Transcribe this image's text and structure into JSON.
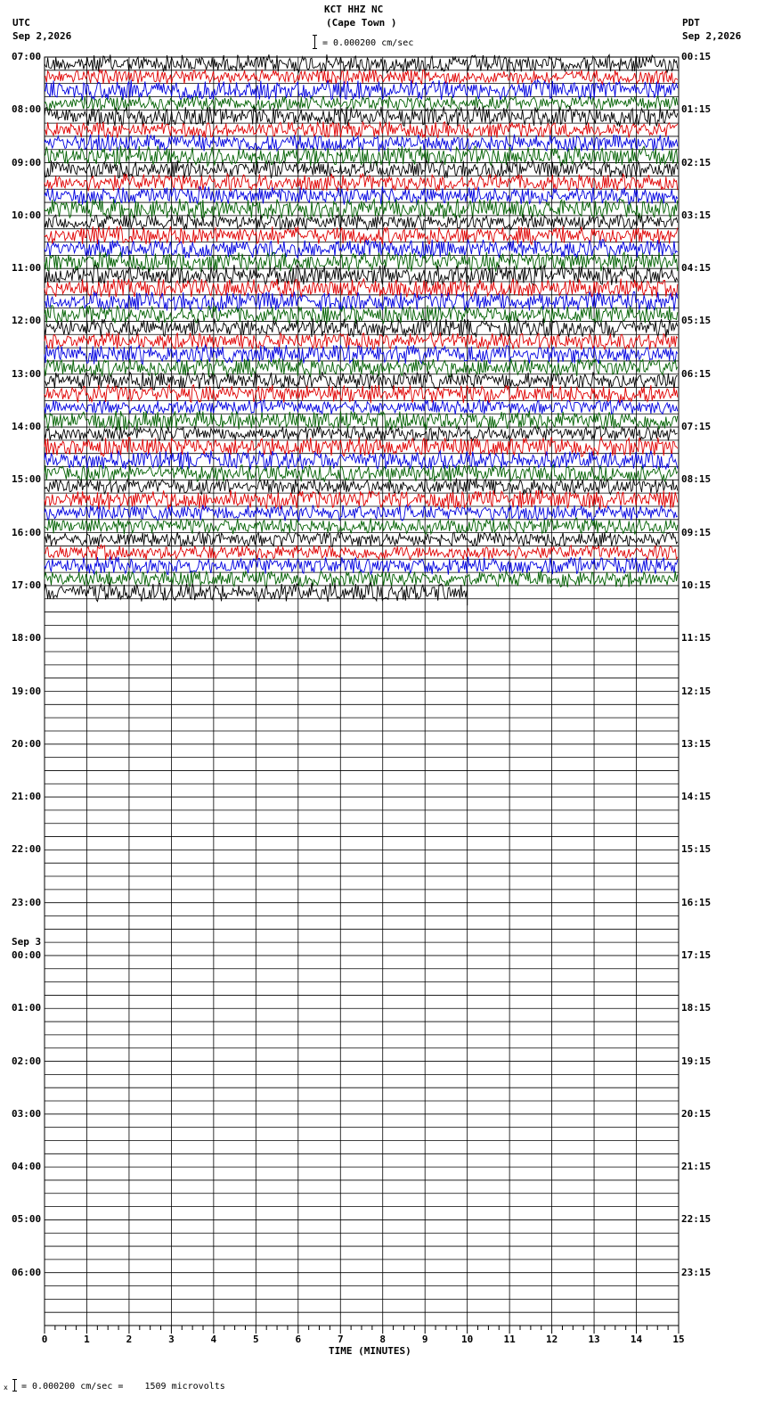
{
  "header": {
    "station": "KCT HHZ NC",
    "location": "(Cape Town )",
    "scale_text": "= 0.000200 cm/sec",
    "left_zone": "UTC",
    "left_date": "Sep 2,2026",
    "right_zone": "PDT",
    "right_date": "Sep 2,2026"
  },
  "footer": {
    "scale_note": "= 0.000200 cm/sec =    1509 microvolts"
  },
  "chart_data": {
    "type": "helicorder",
    "title": "KCT HHZ NC (Cape Town )",
    "xlabel": "TIME (MINUTES)",
    "x_ticks": [
      "0",
      "1",
      "2",
      "3",
      "4",
      "5",
      "6",
      "7",
      "8",
      "9",
      "10",
      "11",
      "12",
      "13",
      "14",
      "15"
    ],
    "xlim": [
      0,
      15
    ],
    "minutes_per_line": 15,
    "lines_total": 96,
    "lines_with_data": 41,
    "last_line_end_minute": 10,
    "trace_colors": [
      "#000000",
      "#e00000",
      "#0000e0",
      "#006000"
    ],
    "utc_labels": [
      "07:00",
      "08:00",
      "09:00",
      "10:00",
      "11:00",
      "12:00",
      "13:00",
      "14:00",
      "15:00",
      "16:00",
      "17:00",
      "18:00",
      "19:00",
      "20:00",
      "21:00",
      "22:00",
      "23:00",
      "00:00",
      "01:00",
      "02:00",
      "03:00",
      "04:00",
      "05:00",
      "06:00"
    ],
    "date_change_label": "Sep 3",
    "date_change_index": 17,
    "pdt_labels": [
      "00:15",
      "01:15",
      "02:15",
      "03:15",
      "04:15",
      "05:15",
      "06:15",
      "07:15",
      "08:15",
      "09:15",
      "10:15",
      "11:15",
      "12:15",
      "13:15",
      "14:15",
      "15:15",
      "16:15",
      "17:15",
      "18:15",
      "19:15",
      "20:15",
      "21:15",
      "22:15",
      "23:15"
    ]
  }
}
